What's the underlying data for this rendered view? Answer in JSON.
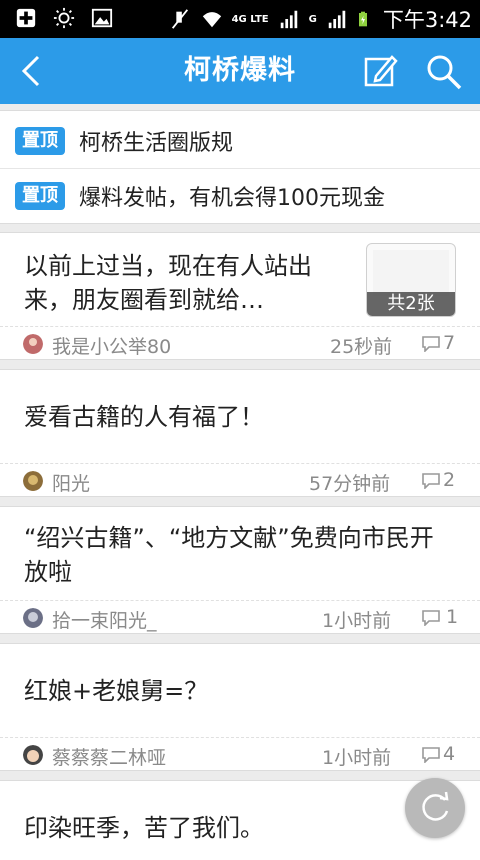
{
  "status_bar": {
    "network_4g_label": "4G LTE",
    "signal_g_label": "G",
    "clock": "下午3:42",
    "icons": [
      "plus-box-icon",
      "brightness-icon",
      "image-icon",
      "mute-icon",
      "wifi-icon",
      "signal-icon",
      "battery-icon"
    ]
  },
  "app_bar": {
    "title": "柯桥爆料",
    "back_icon": "back-arrow-icon",
    "compose_icon": "compose-icon",
    "search_icon": "search-icon",
    "color": "#2c9be8"
  },
  "pinned": [
    {
      "badge": "置顶",
      "text": "柯桥生活圈版规"
    },
    {
      "badge": "置顶",
      "text": "爆料发帖，有机会得100元现金"
    }
  ],
  "posts": [
    {
      "title": "以前上过当，现在有人站出来，朋友圈看到就给…",
      "author": "我是小公举80",
      "time": "25秒前",
      "comments": "7",
      "thumb_label": "共2张"
    },
    {
      "title": "爱看古籍的人有福了！",
      "author": "阳光",
      "time": "57分钟前",
      "comments": "2"
    },
    {
      "title": "“绍兴古籍”、“地方文献”免费向市民开放啦",
      "author": "拾一束阳光_",
      "time": "1小时前",
      "comments": "1"
    },
    {
      "title": "红娘+老娘舅=？",
      "author": "蔡蔡蔡二林哑",
      "time": "1小时前",
      "comments": "4"
    },
    {
      "title": "印染旺季，苦了我们。"
    }
  ],
  "refresh_icon": "refresh-icon"
}
